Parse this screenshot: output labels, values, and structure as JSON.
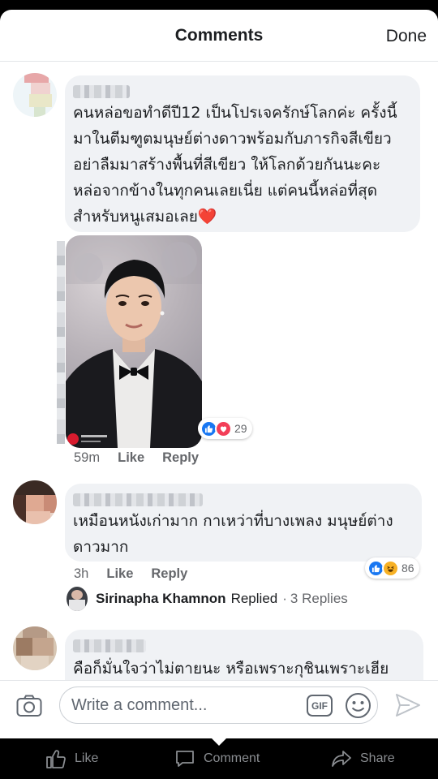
{
  "header": {
    "title": "Comments",
    "done_label": "Done"
  },
  "comments": [
    {
      "text_lines": [
        "คนหล่อขอทำดีปี12 เป็นโปรเจครักษ์โลกค่ะ ครั้งนี้",
        "มาในตีมฑูตมนุษย์ต่างดาวพร้อมกับภารกิจสีเขียว",
        "อย่าลืมมาสร้างพื้นที่สีเขียว ให้โลกด้วยกันนะคะ",
        "หล่อจากข้างในทุกคนเลยเนี่ย แต่คนนี้หล่อที่สุด",
        "สำหรับหนูเสมอเลย"
      ],
      "emoji": "❤️",
      "time": "59m",
      "like_label": "Like",
      "reply_label": "Reply",
      "reaction_count": "29",
      "reactions": [
        "like-icon",
        "love-icon"
      ]
    },
    {
      "text_lines": [
        "เหมือนหนังเก่ามาก กาเหว่าที่บางเพลง มนุษย์ต่าง",
        "ดาวมาก"
      ],
      "time": "3h",
      "like_label": "Like",
      "reply_label": "Reply",
      "reaction_count": "86",
      "reactions": [
        "like-icon",
        "haha-icon"
      ],
      "reply_summary": {
        "name": "Sirinapha Khamnon",
        "replied": "Replied",
        "separator": "·",
        "count": "3 Replies"
      }
    },
    {
      "text_lines": [
        "คือก็มั่นใจว่าไม่ตายนะ หรือเพราะกุชินเพราะเฮีย"
      ]
    }
  ],
  "composer": {
    "placeholder": "Write a comment...",
    "gif_label": "GIF"
  },
  "tabbar": {
    "like": "Like",
    "comment": "Comment",
    "share": "Share"
  },
  "colors": {
    "bubble": "#f0f2f5",
    "link_blue": "#1877f2",
    "love_red": "#f33e58",
    "haha_yellow": "#f7b125",
    "meta_gray": "#65676b"
  }
}
